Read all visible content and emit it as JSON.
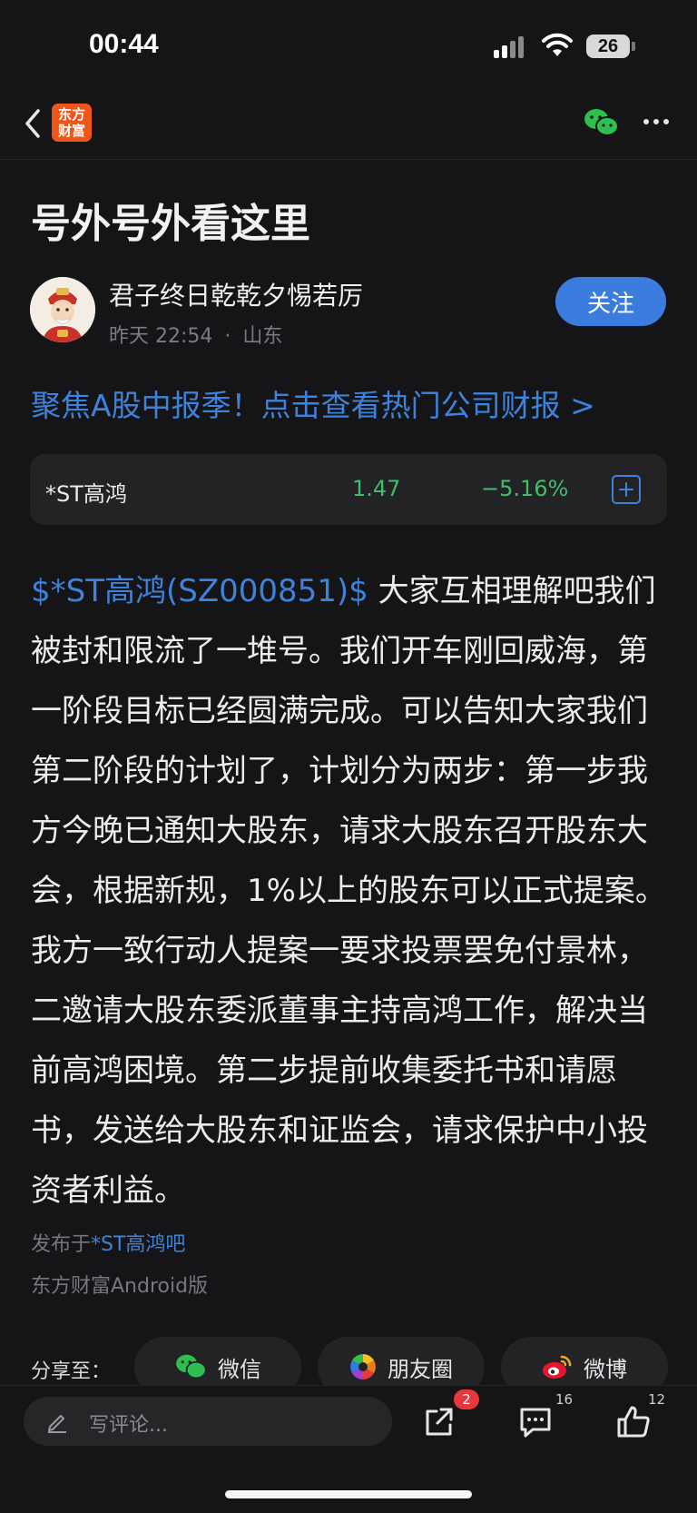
{
  "status_bar": {
    "time": "00:44",
    "battery": "26"
  },
  "nav": {
    "logo_line1": "东方",
    "logo_line2": "财富"
  },
  "post": {
    "title": "号外号外看这里",
    "author": "君子终日乾乾夕惕若厉",
    "time": "昨天 22:54",
    "location": "山东",
    "meta_separator": "·",
    "follow_label": "关注",
    "banner": "聚焦A股中报季！点击查看热门公司财报 >"
  },
  "stock_card": {
    "name": "*ST高鸿",
    "price": "1.47",
    "change": "−5.16%",
    "color": "#3fbf6c"
  },
  "content": {
    "stock_link": "$*ST高鸿(SZ000851)$",
    "text": " 大家互相理解吧我们被封和限流了一堆号。我们开车刚回威海，第一阶段目标已经圆满完成。可以告知大家我们第二阶段的计划了，计划分为两步：第一步我方今晚已通知大股东，请求大股东召开股东大会，根据新规，1%以上的股东可以正式提案。我方一致行动人提案一要求投票罢免付景林，二邀请大股东委派董事主持高鸿工作，解决当前高鸿困境。第二步提前收集委托书和请愿书，发送给大股东和证监会，请求保护中小投资者利益。"
  },
  "footer": {
    "posted_prefix": "发布于",
    "posted_bar": "*ST高鸿吧",
    "client": "东方财富Android版"
  },
  "share": {
    "label": "分享至：",
    "targets": [
      {
        "label": "微信",
        "icon": "wechat-icon"
      },
      {
        "label": "朋友圈",
        "icon": "moments-icon"
      },
      {
        "label": "微博",
        "icon": "weibo-icon"
      }
    ]
  },
  "bottom_bar": {
    "comment_placeholder": "写评论...",
    "share_badge": "2",
    "comment_count": "16",
    "like_count": "12"
  },
  "colors": {
    "accent": "#3a7ddf",
    "link": "#3d83dc",
    "down": "#3fbf6c",
    "background": "#151517"
  }
}
